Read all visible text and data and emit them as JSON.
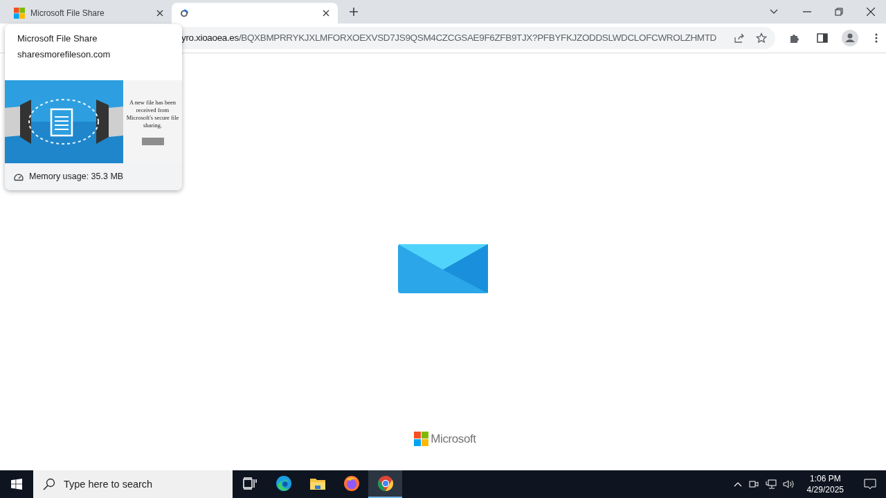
{
  "tabs": [
    {
      "title": "Microsoft File Share",
      "kind": "microsoft",
      "selected": false
    },
    {
      "kind": "loading",
      "selected": true
    }
  ],
  "address_bar": {
    "host": "yro.xioaoea.es",
    "path": "/BQXBMPRRYKJXLMFORXOEXVSD7JS9QSM4CZCGSAE9F6ZFB9TJX?PFBYFKJZODDSLWDCLOFCWROLZHMTD"
  },
  "tab_preview": {
    "title": "Microsoft File Share",
    "domain": "sharesmorefileson.com",
    "thumbnail": {
      "heading": "A new file has been received from Microsoft's secure file sharing."
    },
    "memory": "Memory usage: 35.3 MB"
  },
  "page": {
    "logo_text": "Microsoft"
  },
  "taskbar": {
    "search_placeholder": "Type here to search",
    "apps": [
      {
        "kind": "task-view",
        "selected": false
      },
      {
        "kind": "edge",
        "selected": false
      },
      {
        "kind": "explorer",
        "selected": false
      },
      {
        "kind": "firefox",
        "selected": false
      },
      {
        "kind": "chrome",
        "selected": true
      }
    ],
    "time": "1:06 PM",
    "date": "4/29/2025"
  }
}
